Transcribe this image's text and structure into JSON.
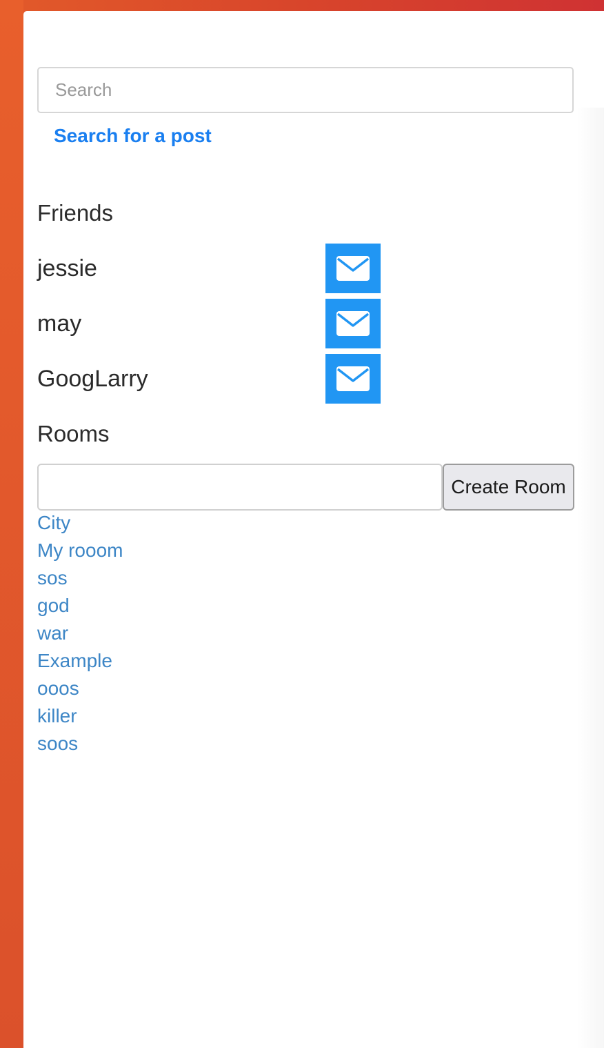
{
  "search": {
    "placeholder": "Search",
    "value": "",
    "link_label": "Search for a post"
  },
  "friends": {
    "heading": "Friends",
    "items": [
      {
        "name": "jessie",
        "action_icon": "envelope-icon"
      },
      {
        "name": "may",
        "action_icon": "envelope-icon"
      },
      {
        "name": "GoogLarry",
        "action_icon": "envelope-icon"
      }
    ]
  },
  "rooms": {
    "heading": "Rooms",
    "new_room_value": "",
    "create_label": "Create Room",
    "items": [
      "City",
      "My rooom",
      "sos",
      "god",
      "war",
      "Example",
      "ooos",
      "killer",
      "soos"
    ]
  },
  "colors": {
    "accent_orange": "#e0562b",
    "message_button": "#2196f3",
    "link_blue": "#1a7ff0",
    "room_link": "#3d86c6"
  }
}
